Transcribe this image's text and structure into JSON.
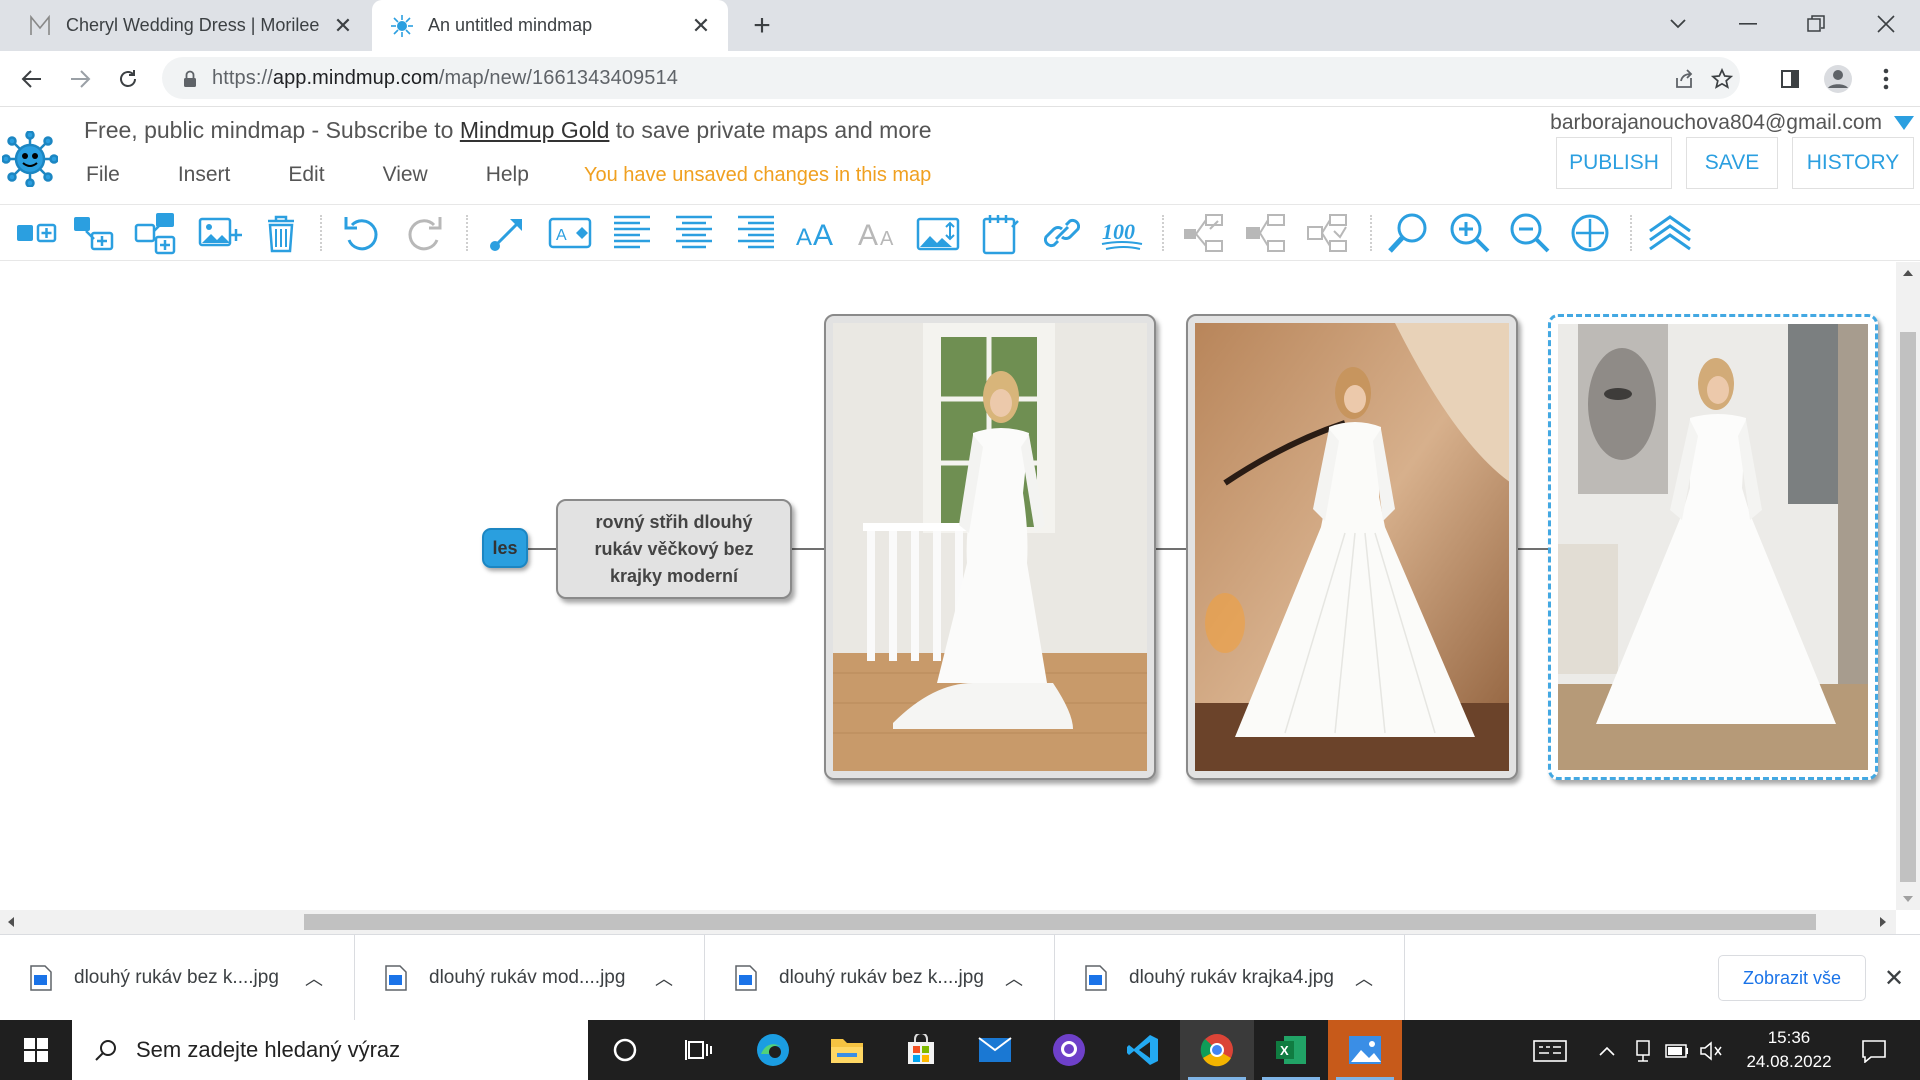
{
  "browser": {
    "tabs": [
      {
        "title": "Cheryl Wedding Dress | Morilee",
        "favicon": "morilee-m-icon",
        "active": false
      },
      {
        "title": "An untitled mindmap",
        "favicon": "mindmup-icon",
        "active": true
      }
    ],
    "url_scheme": "https://",
    "url_host": "app.mindmup.com",
    "url_path": "/map/new/1661343409514"
  },
  "header": {
    "promo_prefix": "Free, public mindmap - Subscribe to",
    "promo_link": "Mindmup Gold",
    "promo_suffix": "to save private maps and more",
    "menu": [
      "File",
      "Insert",
      "Edit",
      "View",
      "Help"
    ],
    "unsaved": "You have unsaved changes in this map",
    "account": "barborajanouchova804@gmail.com",
    "buttons": {
      "publish": "PUBLISH",
      "save": "SAVE",
      "history": "HISTORY"
    },
    "accent": "#2b9fe0"
  },
  "toolbar": {
    "icons": [
      "add-sibling-icon",
      "add-child-icon",
      "add-parent-icon",
      "insert-image-icon",
      "delete-icon",
      "undo-icon",
      "redo-icon",
      "connect-arrow-icon",
      "node-style-icon",
      "align-left-icon",
      "align-center-icon",
      "align-right-icon",
      "font-larger-icon",
      "font-smaller-icon",
      "image-size-icon",
      "note-icon",
      "link-icon",
      "progress-icon",
      "collapse-all-icon",
      "expand-icon",
      "toggle-collapse-icon",
      "search-icon",
      "zoom-in-icon",
      "zoom-out-icon",
      "reset-view-icon",
      "collapse-toolbar-icon"
    ]
  },
  "map": {
    "root": "les",
    "text_node": "rovný střih dlouhý rukáv věčkový bez krajky moderní",
    "image_nodes": [
      "wedding-dress-photo-1",
      "wedding-dress-photo-2",
      "wedding-dress-photo-3"
    ]
  },
  "downloads": {
    "items": [
      "dlouhý rukáv bez k....jpg",
      "dlouhý rukáv mod....jpg",
      "dlouhý rukáv bez k....jpg",
      "dlouhý rukáv krajka4.jpg"
    ],
    "show_all": "Zobrazit vše"
  },
  "taskbar": {
    "search_placeholder": "Sem zadejte hledaný výraz",
    "time": "15:36",
    "date": "24.08.2022"
  }
}
